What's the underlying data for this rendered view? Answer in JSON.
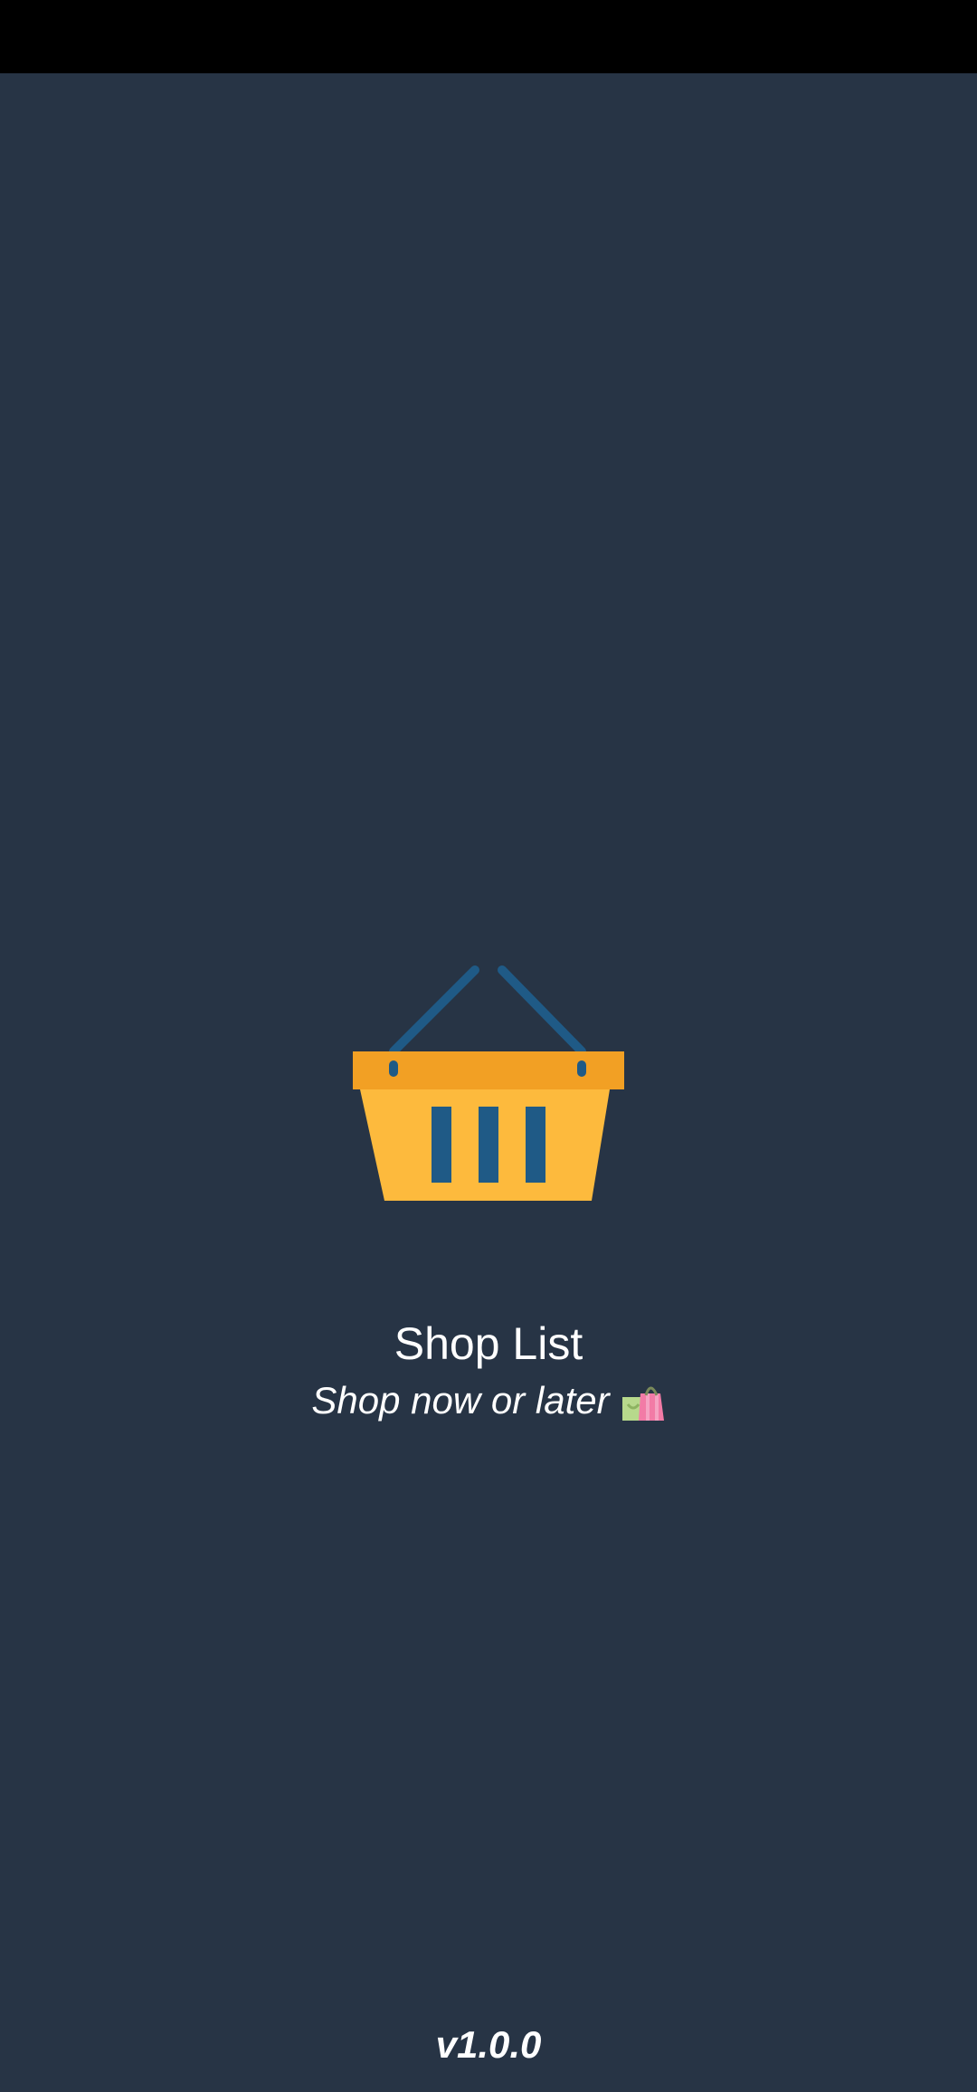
{
  "app": {
    "title": "Shop List",
    "tagline": "Shop now or later",
    "version": "v1.0.0"
  },
  "icons": {
    "logo": "shopping-basket-icon",
    "tagline_emoji": "shopping-bags-icon"
  },
  "colors": {
    "background": "#273445",
    "status_bar": "#000000",
    "basket_rim": "#F2A024",
    "basket_body": "#FDBA3D",
    "basket_accent": "#1F5A86",
    "text": "#FFFFFF"
  }
}
